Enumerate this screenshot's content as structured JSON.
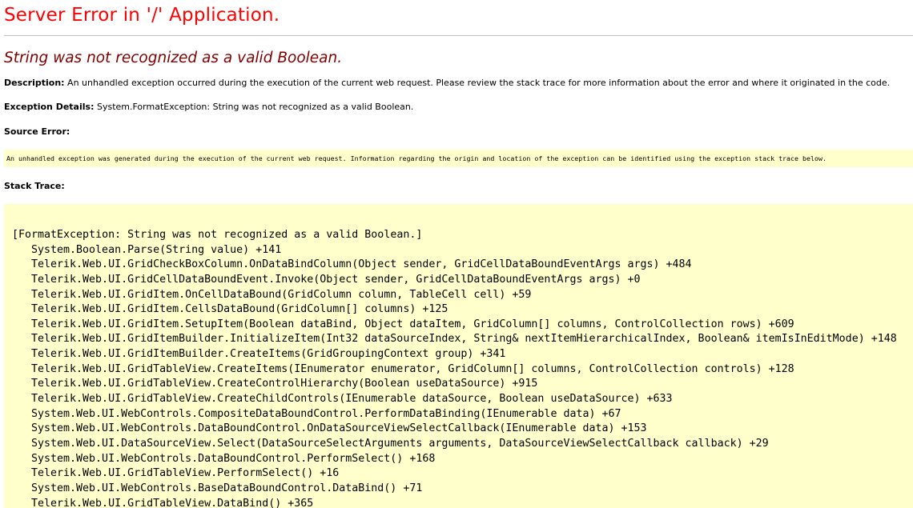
{
  "page_title": "Server Error in '/' Application.",
  "error_message": "String was not recognized as a valid Boolean.",
  "description": {
    "label": "Description:",
    "text": "An unhandled exception occurred during the execution of the current web request. Please review the stack trace for more information about the error and where it originated in the code."
  },
  "exception_details": {
    "label": "Exception Details:",
    "text": "System.FormatException: String was not recognized as a valid Boolean."
  },
  "source_error": {
    "label": "Source Error:",
    "text": "An unhandled exception was generated during the execution of the current web request. Information regarding the origin and location of the exception can be identified using the exception stack trace below."
  },
  "stack_trace": {
    "label": "Stack Trace:",
    "header": "[FormatException: String was not recognized as a valid Boolean.]",
    "frames": [
      "System.Boolean.Parse(String value) +141",
      "Telerik.Web.UI.GridCheckBoxColumn.OnDataBindColumn(Object sender, GridCellDataBoundEventArgs args) +484",
      "Telerik.Web.UI.GridCellDataBoundEvent.Invoke(Object sender, GridCellDataBoundEventArgs args) +0",
      "Telerik.Web.UI.GridItem.OnCellDataBound(GridColumn column, TableCell cell) +59",
      "Telerik.Web.UI.GridItem.CellsDataBound(GridColumn[] columns) +125",
      "Telerik.Web.UI.GridItem.SetupItem(Boolean dataBind, Object dataItem, GridColumn[] columns, ControlCollection rows) +609",
      "Telerik.Web.UI.GridItemBuilder.InitializeItem(Int32 dataSourceIndex, String& nextItemHierarchicalIndex, Boolean& itemIsInEditMode) +148",
      "Telerik.Web.UI.GridItemBuilder.CreateItems(GridGroupingContext group) +341",
      "Telerik.Web.UI.GridTableView.CreateItems(IEnumerator enumerator, GridColumn[] columns, ControlCollection controls) +128",
      "Telerik.Web.UI.GridTableView.CreateControlHierarchy(Boolean useDataSource) +915",
      "Telerik.Web.UI.GridTableView.CreateChildControls(IEnumerable dataSource, Boolean useDataSource) +633",
      "System.Web.UI.WebControls.CompositeDataBoundControl.PerformDataBinding(IEnumerable data) +67",
      "System.Web.UI.WebControls.DataBoundControl.OnDataSourceViewSelectCallback(IEnumerable data) +153",
      "System.Web.UI.DataSourceView.Select(DataSourceSelectArguments arguments, DataSourceViewSelectCallback callback) +29",
      "System.Web.UI.WebControls.DataBoundControl.PerformSelect() +168",
      "Telerik.Web.UI.GridTableView.PerformSelect() +16",
      "System.Web.UI.WebControls.BaseDataBoundControl.DataBind() +71",
      "Telerik.Web.UI.GridTableView.DataBind() +365"
    ]
  }
}
